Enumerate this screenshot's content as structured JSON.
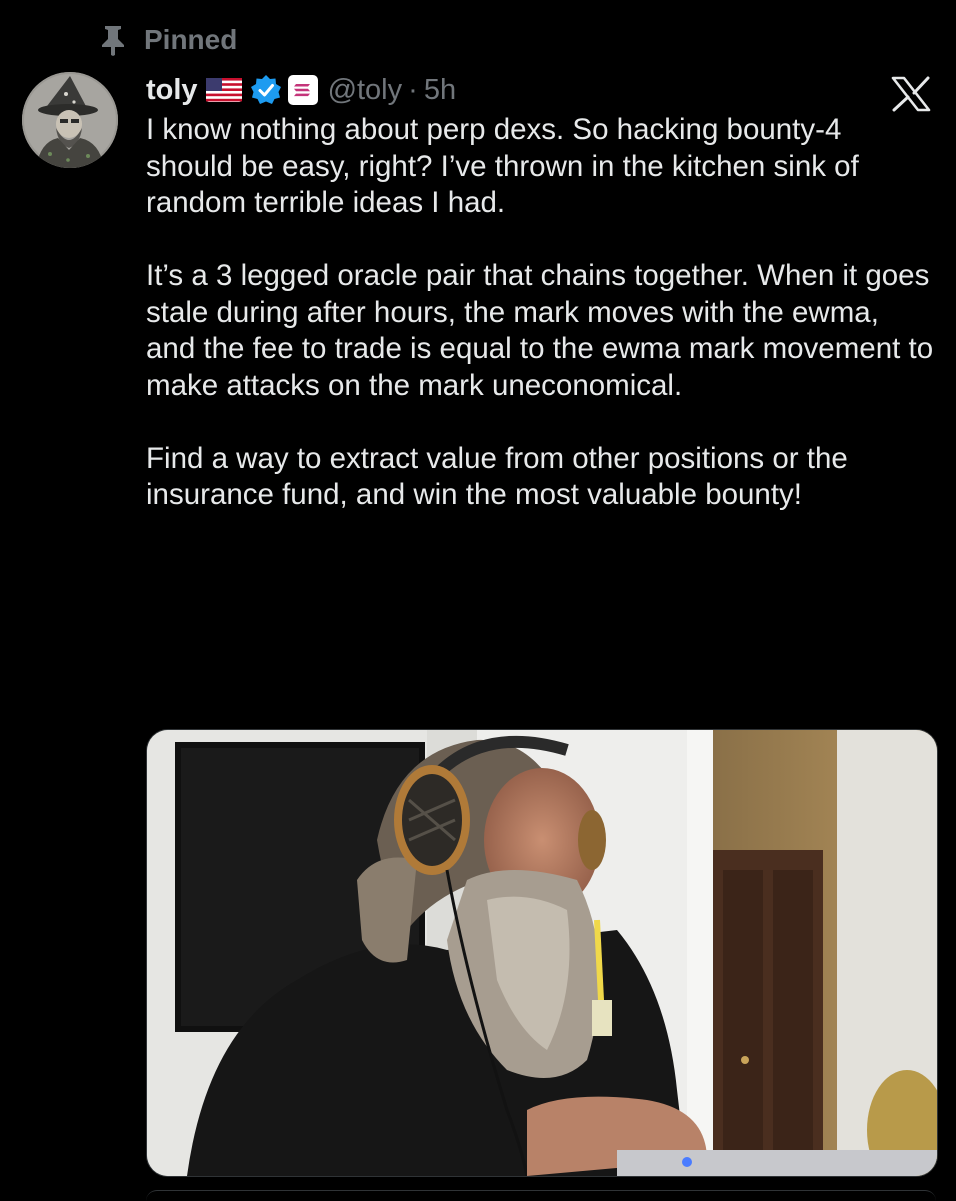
{
  "pinned": {
    "label": "Pinned",
    "icon": "pin-icon"
  },
  "author": {
    "name": "toly",
    "handle": "@toly",
    "separator": "·",
    "time": "5h",
    "badges": [
      "us-flag-icon",
      "verified-icon",
      "solana-icon"
    ],
    "verified_color": "#1d9bf0"
  },
  "actions": {
    "close_icon": "x-close-icon"
  },
  "tweet": {
    "paragraphs": [
      "I know nothing about perp dexs.  So hacking bounty-4 should be easy, right?  I’ve thrown in the kitchen sink of random terrible ideas I had.",
      "It’s a 3 legged oracle pair that chains together. When it goes stale during after hours, the mark moves with the ewma, and the fee to trade is equal to the ewma mark movement to make attacks on the mark uneconomical.",
      "Find a way to extract value from other positions or the insurance fund, and win the most valuable bounty!"
    ]
  },
  "colors": {
    "background": "#000000",
    "text": "#e7e9ea",
    "muted": "#71767b",
    "border": "#2f3336"
  }
}
